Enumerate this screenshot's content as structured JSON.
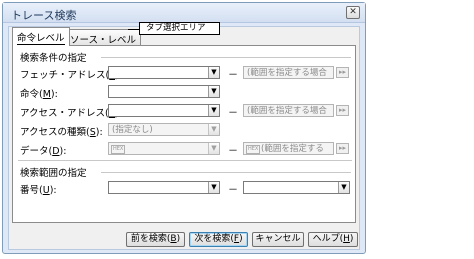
{
  "window": {
    "title": "トレース検索",
    "close_glyph": "✕"
  },
  "tabs": [
    {
      "label": "命令レベル"
    },
    {
      "label": "ソース・レベル"
    }
  ],
  "callout": "タブ選択エリア",
  "search_conditions": {
    "heading": "検索条件の指定",
    "fetch_address": {
      "label": "フェッチ・アドレス(",
      "key": "T",
      "end": "):",
      "value": "",
      "range_dash": "－",
      "range_placeholder": "(範囲を指定する場合",
      "arrow": "▸▸"
    },
    "instruction": {
      "label": "命令(",
      "key": "M",
      "end": "):",
      "value": ""
    },
    "access_address": {
      "label": "アクセス・アドレス(",
      "key": "A",
      "end": "):",
      "value": "",
      "range_dash": "－",
      "range_placeholder": "(範囲を指定する場合",
      "arrow": "▸▸"
    },
    "access_type": {
      "label": "アクセスの種類(",
      "key": "S",
      "end": "):",
      "value": "(指定なし)"
    },
    "data": {
      "label": "データ(",
      "key": "D",
      "end": "):",
      "hex_badge": "HEX",
      "value": "",
      "range_dash": "－",
      "range_hex_badge": "HEX",
      "range_placeholder": "(範囲を指定する",
      "arrow": "▸▸"
    }
  },
  "search_range": {
    "heading": "検索範囲の指定",
    "number": {
      "label": "番号(",
      "key": "U",
      "end": "):",
      "from": "",
      "range_dash": "－",
      "to": ""
    }
  },
  "buttons": {
    "prev": {
      "label": "前を検索(",
      "key": "B",
      "end": ")"
    },
    "next": {
      "label": "次を検索(",
      "key": "F",
      "end": ")"
    },
    "cancel": {
      "label": "キャンセル"
    },
    "help": {
      "label": "ヘルプ(",
      "key": "H",
      "end": ")"
    }
  },
  "icons": {
    "dropdown": "▼"
  }
}
